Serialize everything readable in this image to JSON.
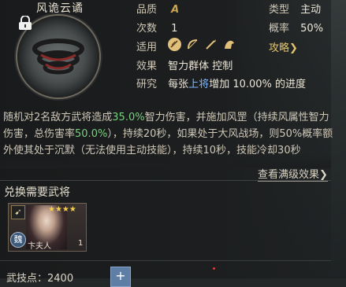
{
  "skill": {
    "title": "风诡云谲",
    "quality_label": "品质",
    "quality_value": "A",
    "type_label": "类型",
    "type_value": "主动",
    "times_label": "次数",
    "times_value": "1",
    "rate_label": "概率",
    "rate_value": "50%",
    "fit_label": "适用",
    "strategy_link": "攻略❯",
    "effect_label": "效果",
    "effect_value": "智力群体 控制",
    "research_label": "研究",
    "research_pre": "每张",
    "research_hl": "上将",
    "research_post": "增加 10.00% 的进度"
  },
  "description": {
    "p1": "随机对2名敌方武将造成",
    "p1_hl": "35.0%",
    "p2": "智力伤害，并施加风罡（持续风属性智力伤害，总伤害率",
    "p2_hl": "50.0%",
    "p3": "），持续20秒，如果处于大风战场，则50%概率额外使其处于沉默（无法使用主动技能），持续10秒，技能冷却30秒"
  },
  "full_effect_link": "查看满级效果❯",
  "required": {
    "title": "兑换需要武将",
    "card": {
      "name": "卞夫人",
      "count": "1",
      "stars": "★★★★",
      "faction": "魏",
      "unit_icon": "bow-icon"
    }
  },
  "footer": {
    "points_label": "武技点：2400",
    "plus_label": "+"
  },
  "colors": {
    "accent_gold": "#e3c56f",
    "highlight_green": "#79d07f",
    "highlight_blue": "#7fb8ff"
  }
}
